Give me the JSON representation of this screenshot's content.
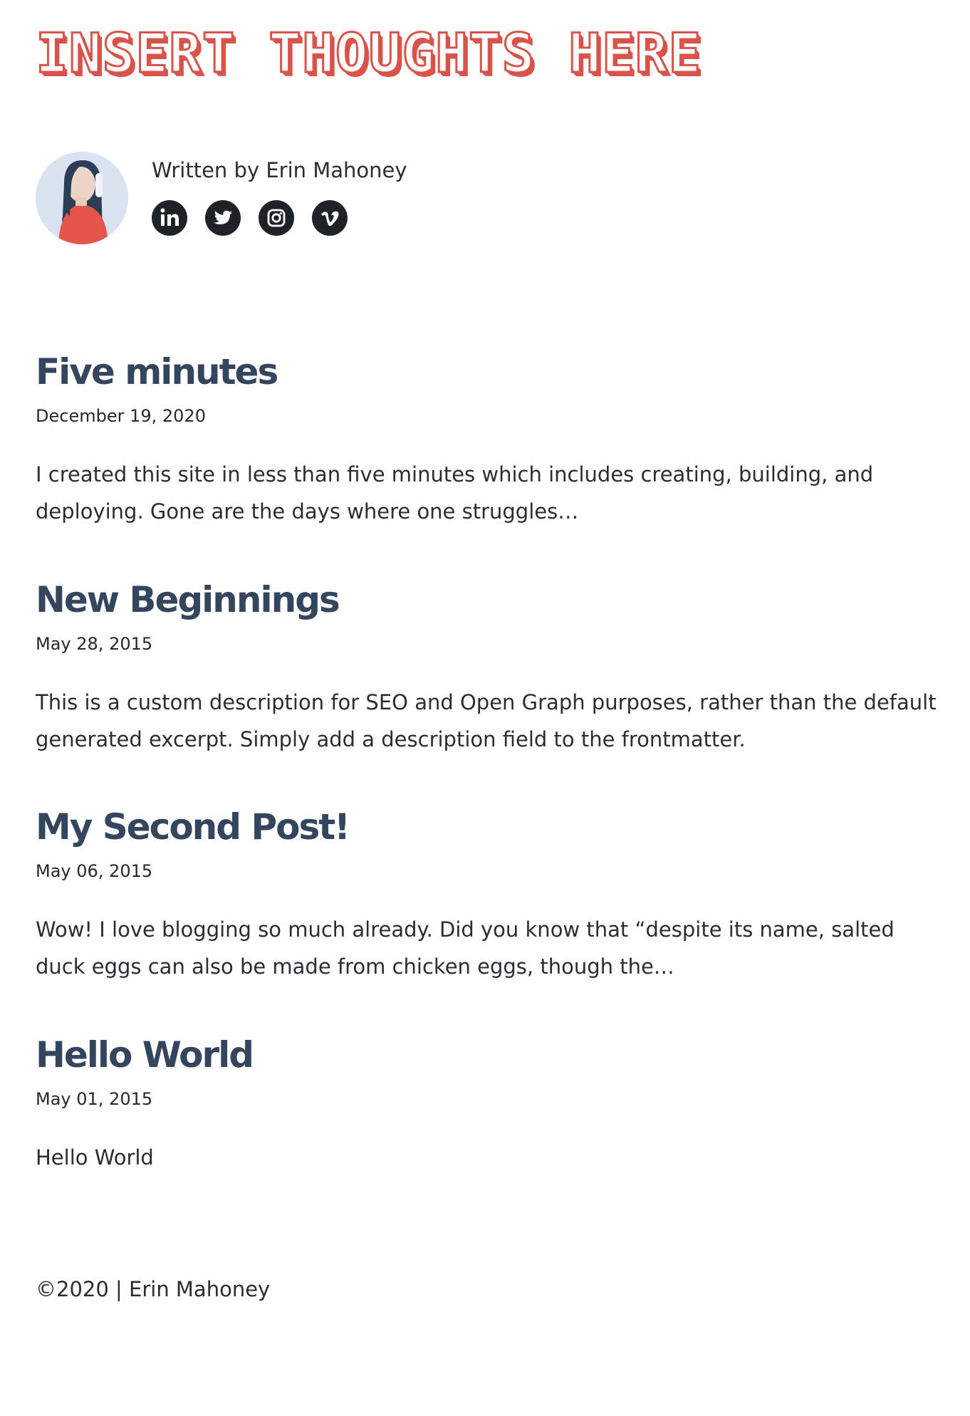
{
  "site": {
    "title": "INSERT THOUGHTS HERE",
    "title_color": "#d9534a"
  },
  "bio": {
    "text": "Written by Erin Mahoney",
    "socials": [
      {
        "name": "linkedin",
        "icon": "linkedin-icon"
      },
      {
        "name": "twitter",
        "icon": "twitter-icon"
      },
      {
        "name": "instagram",
        "icon": "instagram-icon"
      },
      {
        "name": "vimeo",
        "icon": "vimeo-icon"
      }
    ]
  },
  "posts": [
    {
      "title": "Five minutes",
      "date": "December 19, 2020",
      "excerpt": "I created this site in less than five minutes which includes creating, building, and deploying. Gone are the days where one struggles…"
    },
    {
      "title": "New Beginnings",
      "date": "May 28, 2015",
      "excerpt": "This is a custom description for SEO and Open Graph purposes, rather than the default generated excerpt. Simply add a description field to the frontmatter."
    },
    {
      "title": "My Second Post!",
      "date": "May 06, 2015",
      "excerpt": "Wow! I love blogging so much already. Did you know that “despite its name, salted duck eggs can also be made from chicken eggs, though the…"
    },
    {
      "title": "Hello World",
      "date": "May 01, 2015",
      "excerpt": "Hello World"
    }
  ],
  "footer": {
    "text": "©2020 | Erin Mahoney"
  },
  "colors": {
    "heading": "#33465e",
    "icon_bg": "#1f2328",
    "avatar_bg": "#d9e3ef",
    "avatar_shirt": "#e4564c"
  }
}
